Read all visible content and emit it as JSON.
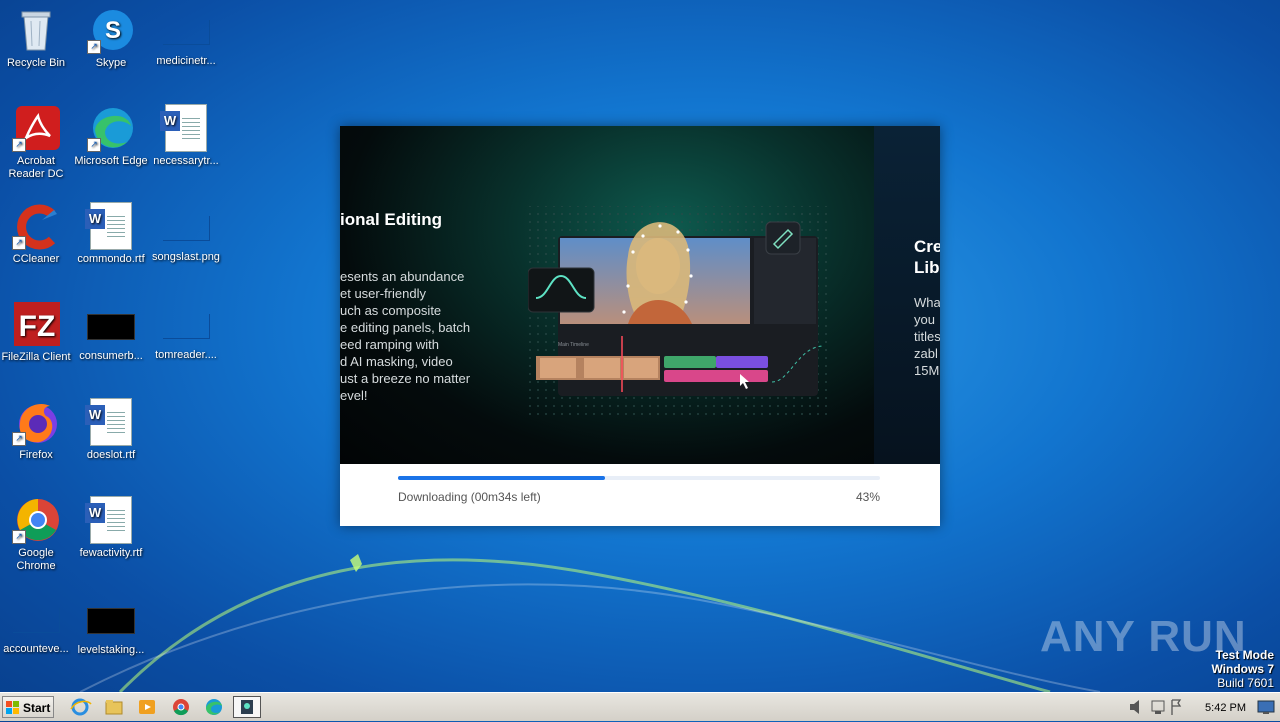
{
  "desktop": {
    "icons": [
      {
        "label": "Recycle Bin"
      },
      {
        "label": "Skype"
      },
      {
        "label": "medicinetr..."
      },
      {
        "label": "Acrobat Reader DC"
      },
      {
        "label": "Microsoft Edge"
      },
      {
        "label": "necessarytr..."
      },
      {
        "label": "CCleaner"
      },
      {
        "label": "commondo.rtf"
      },
      {
        "label": "songslast.png"
      },
      {
        "label": "FileZilla Client"
      },
      {
        "label": "consumerb..."
      },
      {
        "label": "tomreader...."
      },
      {
        "label": "Firefox"
      },
      {
        "label": "doeslot.rtf"
      },
      {
        "label": "Google Chrome"
      },
      {
        "label": "fewactivity.rtf"
      },
      {
        "label": "accounteve..."
      },
      {
        "label": "levelstaking..."
      }
    ]
  },
  "installer": {
    "slide1": {
      "title": "ional Editing",
      "body": "esents an abundance\net user-friendly\nuch as composite\ne editing panels, batch\need ramping with\nd AI masking, video\nust a breeze no matter\nevel!"
    },
    "slide2": {
      "title": "Cre\nLib",
      "body": "Wha\nyou\ntitles\nzabl\n15M"
    },
    "mock": {
      "timeline_label": "Main Timeline"
    },
    "progress": {
      "status": "Downloading (00m34s left)",
      "percent_text": "43%",
      "fraction": 0.43
    }
  },
  "watermark": {
    "brand": "ANY RUN",
    "line1": "Test Mode",
    "line2": "Windows 7",
    "line3": "Build 7601"
  },
  "taskbar": {
    "start_label": "Start",
    "clock": "5:42 PM"
  }
}
